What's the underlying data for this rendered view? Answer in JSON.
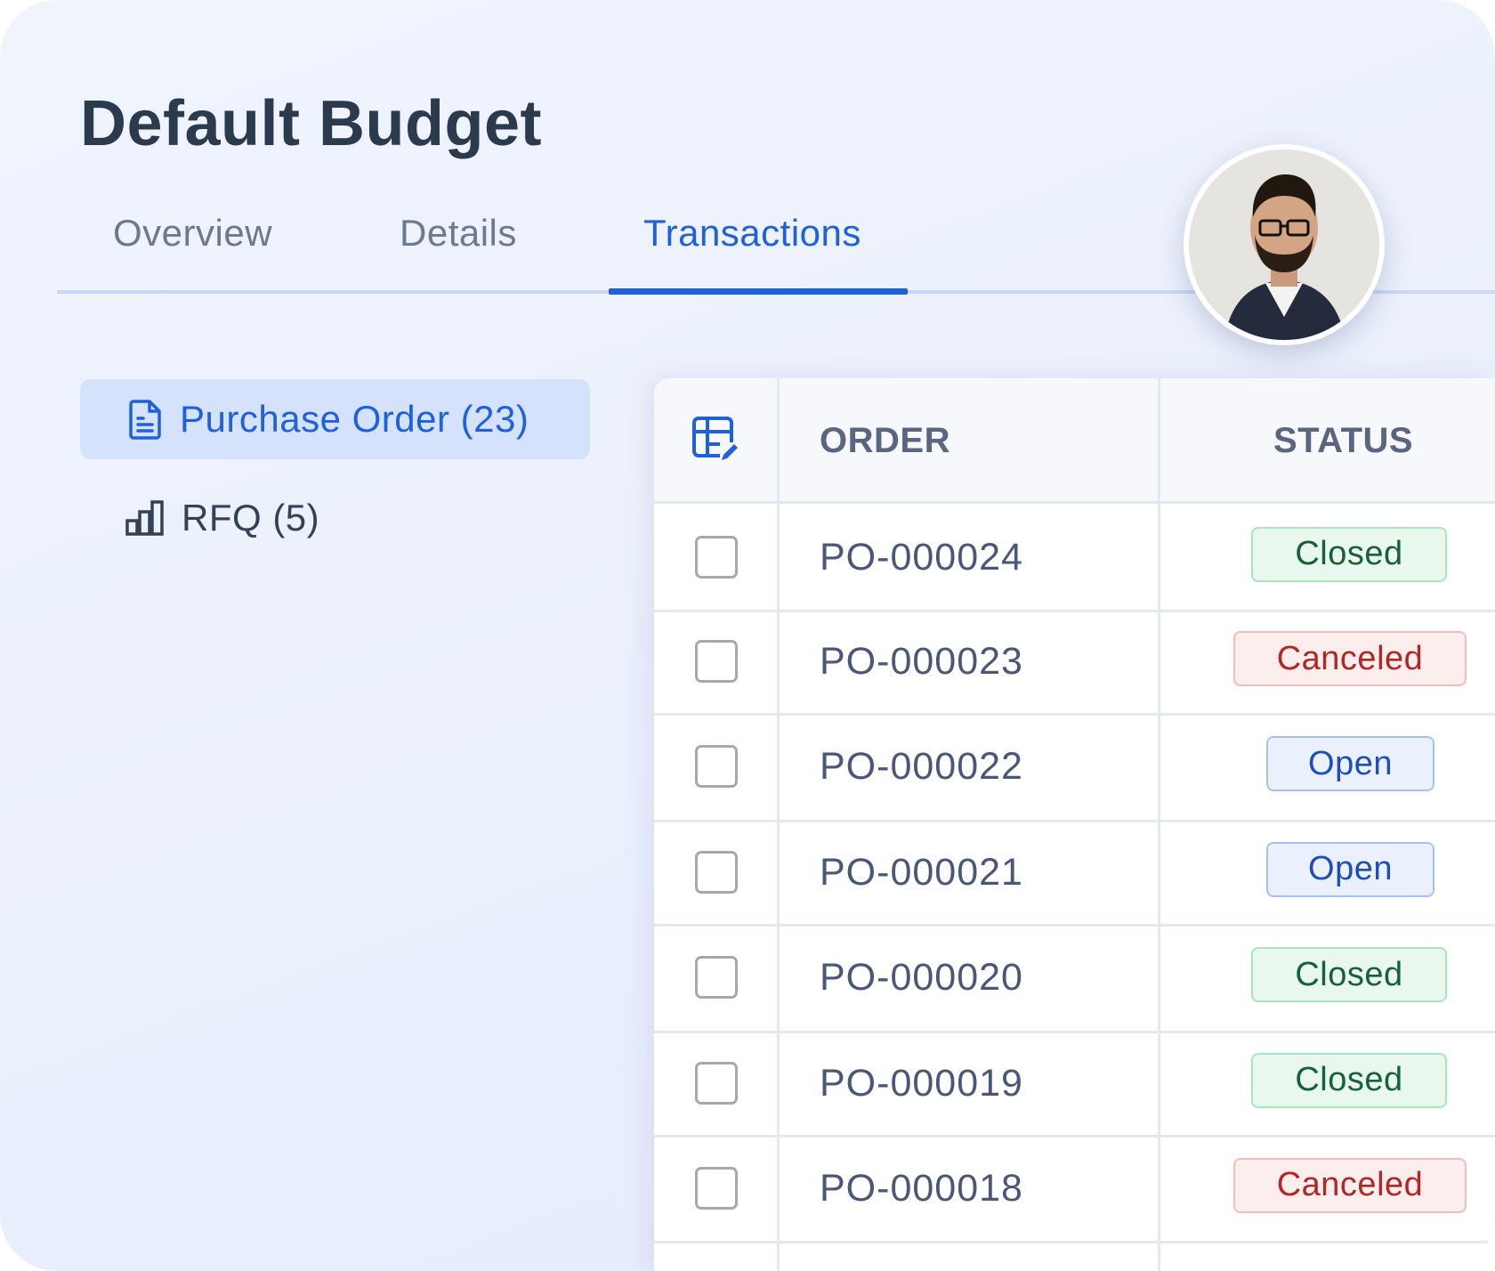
{
  "page": {
    "title": "Default Budget"
  },
  "tabs": [
    {
      "label": "Overview",
      "active": false
    },
    {
      "label": "Details",
      "active": false
    },
    {
      "label": "Transactions",
      "active": true
    }
  ],
  "sidebar": {
    "items": [
      {
        "label": "Purchase Order (23)",
        "icon": "document-icon",
        "active": true
      },
      {
        "label": "RFQ (5)",
        "icon": "bar-chart-icon",
        "active": false
      }
    ]
  },
  "table": {
    "column_icon": "table-edit-icon",
    "columns": [
      "ORDER",
      "STATUS"
    ],
    "rows": [
      {
        "order": "PO-000024",
        "status": "Closed"
      },
      {
        "order": "PO-000023",
        "status": "Canceled"
      },
      {
        "order": "PO-000022",
        "status": "Open"
      },
      {
        "order": "PO-000021",
        "status": "Open"
      },
      {
        "order": "PO-000020",
        "status": "Closed"
      },
      {
        "order": "PO-000019",
        "status": "Closed"
      },
      {
        "order": "PO-000018",
        "status": "Canceled"
      }
    ]
  },
  "colors": {
    "accent": "#1f60db",
    "closed": "#17603a",
    "canceled": "#b42626",
    "open": "#1f4fb5"
  }
}
